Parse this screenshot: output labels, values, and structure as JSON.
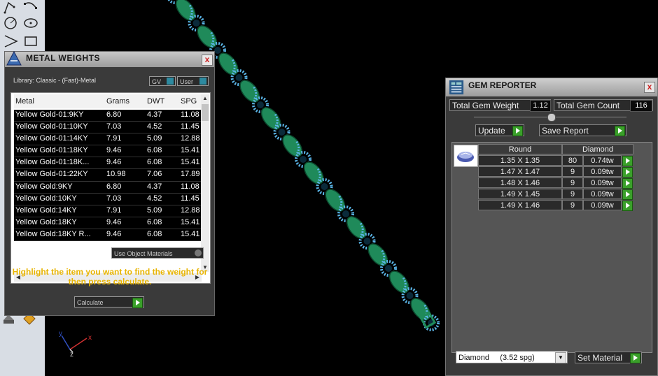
{
  "metal_weights": {
    "title": "METAL WEIGHTS",
    "close_glyph": "x",
    "library_label": "Library: Classic - (Fast)-Metal",
    "gv_label": "GV",
    "user_label": "User",
    "columns": [
      "Metal",
      "Grams",
      "DWT",
      "SPG"
    ],
    "rows": [
      [
        "Yellow Gold-01:9KY",
        "6.80",
        "4.37",
        "11.08"
      ],
      [
        "Yellow Gold-01:10KY",
        "7.03",
        "4.52",
        "11.45"
      ],
      [
        "Yellow Gold-01:14KY",
        "7.91",
        "5.09",
        "12.88"
      ],
      [
        "Yellow Gold-01:18KY",
        "9.46",
        "6.08",
        "15.41"
      ],
      [
        "Yellow Gold-01:18K...",
        "9.46",
        "6.08",
        "15.41"
      ],
      [
        "Yellow Gold-01:22KY",
        "10.98",
        "7.06",
        "17.89"
      ],
      [
        "Yellow Gold:9KY",
        "6.80",
        "4.37",
        "11.08"
      ],
      [
        "Yellow Gold:10KY",
        "7.03",
        "4.52",
        "11.45"
      ],
      [
        "Yellow Gold:14KY",
        "7.91",
        "5.09",
        "12.88"
      ],
      [
        "Yellow Gold:18KY",
        "9.46",
        "6.08",
        "15.41"
      ],
      [
        "Yellow Gold:18KY R...",
        "9.46",
        "6.08",
        "15.41"
      ]
    ],
    "use_object_materials": "Use Object Materials",
    "hint": "Highlight the item you want to find the weight for then press calculate.",
    "calculate_label": "Calculate"
  },
  "gem_reporter": {
    "title": "GEM REPORTER",
    "close_glyph": "x",
    "total_gem_weight_label": "Total Gem Weight",
    "total_gem_weight_value": "1.12",
    "total_gem_count_label": "Total Gem Count",
    "total_gem_count_value": "116",
    "update_label": "Update",
    "save_report_label": "Save Report",
    "shape_header": "Round",
    "material_header": "Diamond",
    "gems": [
      {
        "size": "1.35 X 1.35",
        "count": "80",
        "weight": "0.74tw"
      },
      {
        "size": "1.47 X 1.47",
        "count": "9",
        "weight": "0.09tw"
      },
      {
        "size": "1.48 X 1.46",
        "count": "9",
        "weight": "0.09tw"
      },
      {
        "size": "1.49 X 1.45",
        "count": "9",
        "weight": "0.09tw"
      },
      {
        "size": "1.49 X 1.46",
        "count": "9",
        "weight": "0.09tw"
      }
    ],
    "material_select": "Diamond     (3.52 spg)",
    "set_material_label": "Set Material"
  },
  "axes": {
    "x": "x",
    "y": "y",
    "z": "z"
  },
  "colors": {
    "hint": "#e8b400",
    "go": "#3aa02a",
    "chain_green": "#1f8a5a",
    "gem_blue": "#5ab4e6"
  }
}
